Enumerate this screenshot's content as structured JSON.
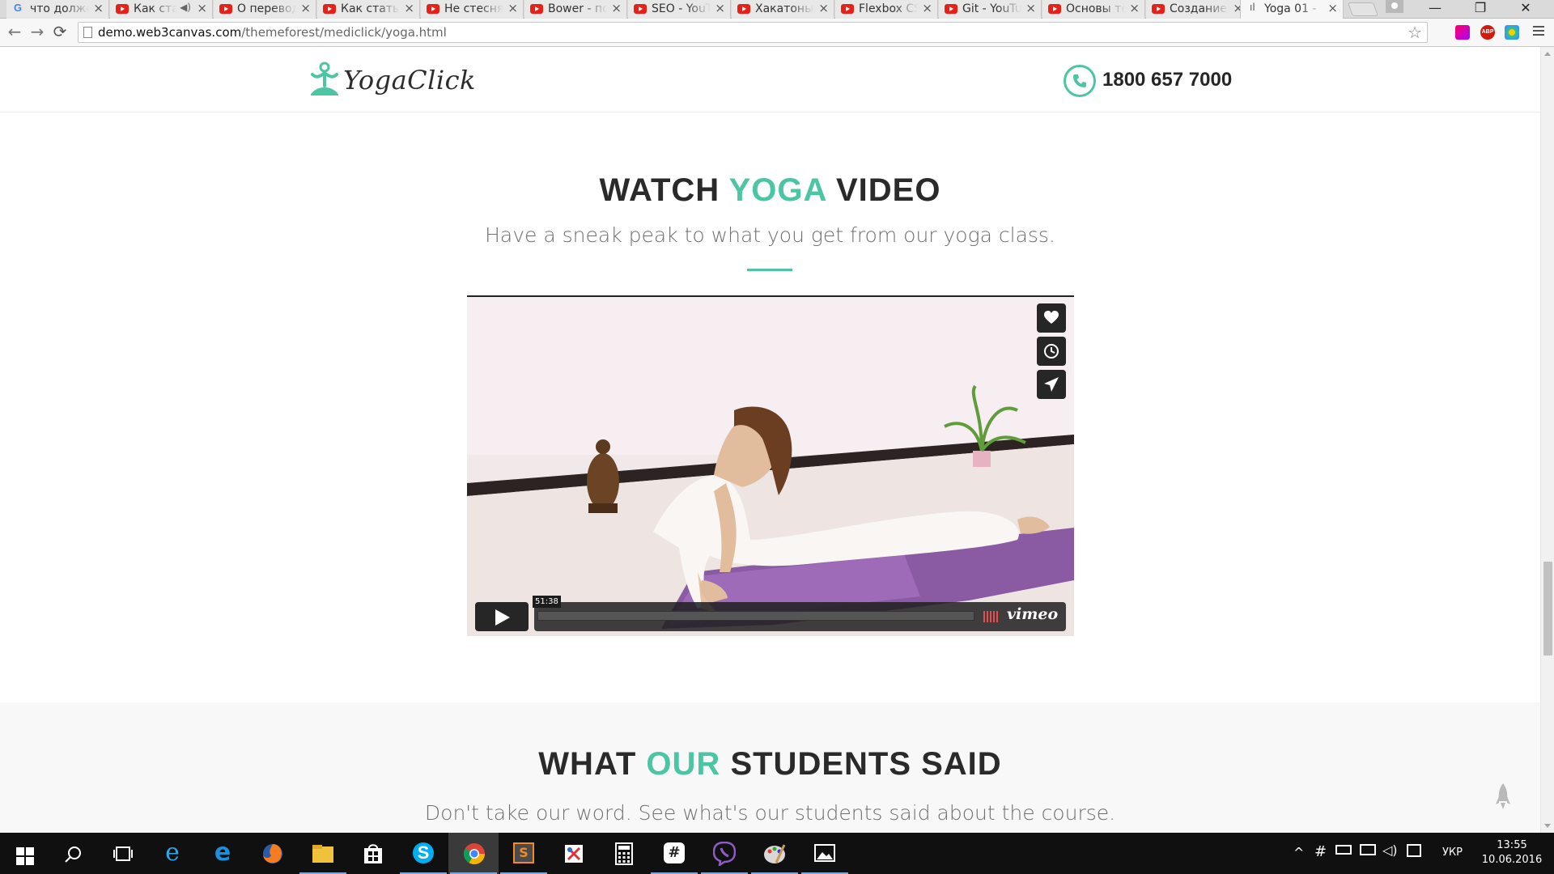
{
  "browser": {
    "tabs": [
      {
        "title": "что должен знать",
        "icon": "google-icon",
        "active": false
      },
      {
        "title": "Как стать",
        "icon": "youtube-icon",
        "active": false,
        "audio": true
      },
      {
        "title": "О переводе",
        "icon": "youtube-icon",
        "active": false
      },
      {
        "title": "Как стать фронтенд",
        "icon": "youtube-icon",
        "active": false
      },
      {
        "title": "Не стесняйтесь",
        "icon": "youtube-icon",
        "active": false
      },
      {
        "title": "Bower - по",
        "icon": "youtube-icon",
        "active": false
      },
      {
        "title": "SEO - YouTube",
        "icon": "youtube-icon",
        "active": false
      },
      {
        "title": "Хакатоны",
        "icon": "youtube-icon",
        "active": false
      },
      {
        "title": "Flexbox CSS",
        "icon": "youtube-icon",
        "active": false
      },
      {
        "title": "Git - YouTube",
        "icon": "youtube-icon",
        "active": false
      },
      {
        "title": "Основы те",
        "icon": "youtube-icon",
        "active": false
      },
      {
        "title": "Создание",
        "icon": "youtube-icon",
        "active": false
      },
      {
        "title": "Yoga 01 - ",
        "icon": "yoga-favicon-icon",
        "active": true
      }
    ],
    "close_glyph": "×",
    "url_host": "demo.web3canvas.com",
    "url_path": "/themeforest/mediclick/yoga.html",
    "window_controls": {
      "minimize": "—",
      "maximize": "❐",
      "close": "✕"
    },
    "nav": {
      "back": "←",
      "forward": "→",
      "reload": "⟳"
    },
    "star": "☆",
    "abp_label": "ABP"
  },
  "site": {
    "logo_text": "YogaClick",
    "phone": "1800 657 7000",
    "accent_color": "#4cc5a5"
  },
  "video_section": {
    "title_before": "WATCH",
    "title_accent": "YOGA",
    "title_after": "VIDEO",
    "subtitle": "Have a sneak peak to what you get from our yoga class.",
    "player": {
      "time": "51:38",
      "brand": "vimeo",
      "side_buttons": [
        "like-icon",
        "watch-later-icon",
        "share-icon"
      ]
    }
  },
  "students_section": {
    "title_before": "WHAT",
    "title_accent": "OUR",
    "title_after": "STUDENTS SAID",
    "subtitle": "Don't take our word. See what's our students said about the course."
  },
  "taskbar": {
    "apps": [
      "search-icon",
      "task-view-icon",
      "internet-explorer-icon",
      "edge-icon",
      "firefox-icon",
      "file-explorer-icon",
      "store-icon",
      "skype-icon",
      "chrome-icon",
      "sublime-text-icon",
      "snipping-tool-icon",
      "calculator-icon",
      "slack-icon",
      "viber-icon",
      "paint-icon",
      "photos-icon"
    ],
    "language": "УКР",
    "time": "13:55",
    "date": "10.06.2016"
  }
}
